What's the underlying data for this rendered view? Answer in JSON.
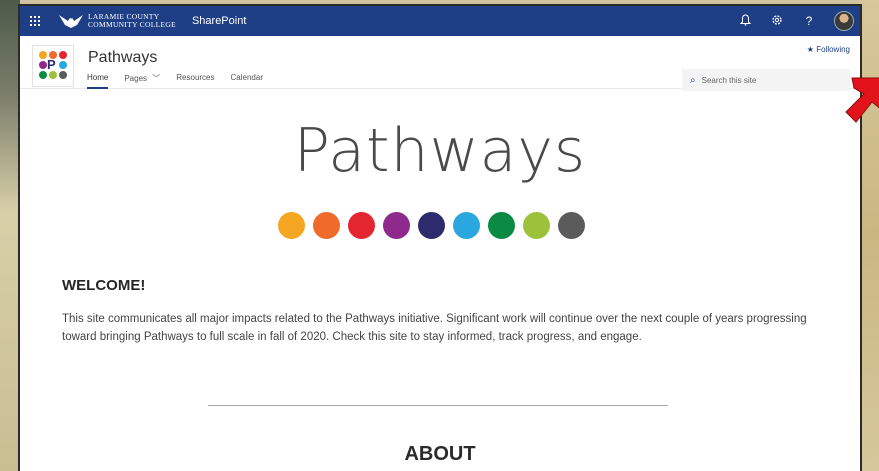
{
  "suitebar": {
    "brand_line1": "LARAMIE COUNTY",
    "brand_line2": "COMMUNITY COLLEGE",
    "app_name": "SharePoint",
    "icons": [
      "app-launcher-icon",
      "bell-icon",
      "gear-icon",
      "help-icon",
      "avatar"
    ]
  },
  "site": {
    "title": "Pathways",
    "nav": {
      "home": "Home",
      "pages": "Pages",
      "resources": "Resources",
      "calendar": "Calendar"
    },
    "following": "Following",
    "search_placeholder": "Search this site"
  },
  "hero": {
    "title": "Pathways",
    "dot_colors": [
      "#f5a623",
      "#ef6a2b",
      "#e3262f",
      "#8e2a8e",
      "#2e2a6e",
      "#2aa7df",
      "#0b8a44",
      "#9cc13b",
      "#5b5b5b"
    ]
  },
  "welcome": {
    "heading": "WELCOME!",
    "body": "This site communicates all major impacts related to the Pathways initiative. Significant work will continue over the next couple of years progressing toward bringing Pathways to full scale in fall of 2020. Check this site to stay informed, track progress, and engage."
  },
  "about": {
    "heading": "ABOUT"
  },
  "colors": {
    "suitebar": "#1e3f86",
    "annotation_arrow": "#e3131b"
  }
}
